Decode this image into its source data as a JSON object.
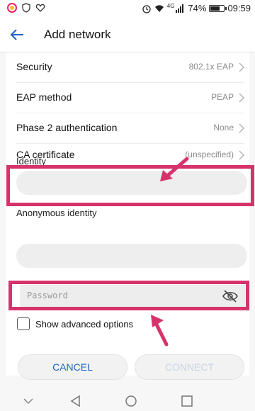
{
  "status_bar": {
    "network_label": "4G",
    "battery": "74%",
    "battery_level": 0.74,
    "time": "09:59"
  },
  "header": {
    "title": "Add network"
  },
  "settings": [
    {
      "label": "Security",
      "value": "802.1x EAP"
    },
    {
      "label": "EAP method",
      "value": "PEAP"
    },
    {
      "label": "Phase 2 authentication",
      "value": "None"
    },
    {
      "label": "CA certificate",
      "value": "(unspecified)"
    }
  ],
  "identity": {
    "label": "Identity",
    "value": ""
  },
  "anonymous_identity": {
    "label": "Anonymous identity",
    "value": ""
  },
  "password": {
    "placeholder": "Password"
  },
  "advanced": {
    "label": "Show advanced options",
    "checked": false
  },
  "buttons": {
    "cancel": "CANCEL",
    "connect": "CONNECT"
  },
  "colors": {
    "highlight": "#d6336c",
    "accent": "#1b65c7",
    "disabled": "#c9d3e3"
  },
  "icons": [
    "back-arrow-icon",
    "chevron-right-icon",
    "eye-off-icon",
    "nav-down-icon",
    "nav-back-icon",
    "nav-home-icon",
    "nav-recents-icon"
  ]
}
